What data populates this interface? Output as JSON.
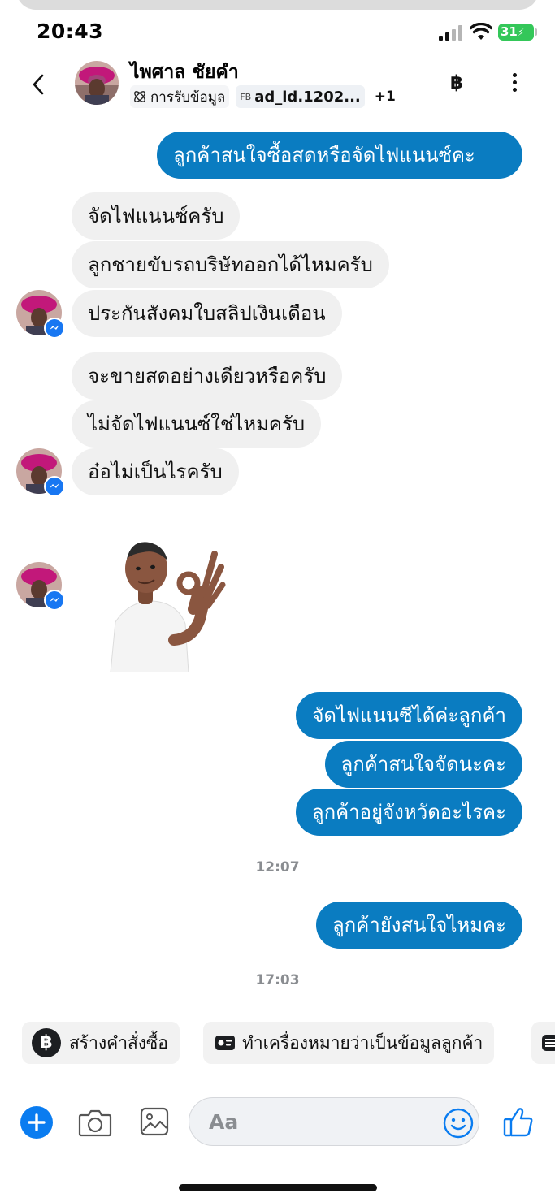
{
  "status_bar": {
    "time": "20:43",
    "battery": "31"
  },
  "header": {
    "contact_name": "ไพศาล ชัยคำ",
    "tag_label": "การรับข้อมูล",
    "ad_prefix": "FB",
    "ad_id": "ad_id.1202...",
    "more_tags": "+1",
    "currency_icon": "฿"
  },
  "messages": {
    "partial_outgoing": "ลูกค้าสนใจซื้อสดหรือจัดไฟแนนซ์คะ",
    "in_1": "จัดไฟแนนซ์ครับ",
    "in_2": "ลูกชายขับรถบริษัทออกได้ไหมครับ",
    "in_3": "ประกันสังคมใบสลิปเงินเดือน",
    "in_4": "จะขายสดอย่างเดียวหรือครับ",
    "in_5": "ไม่จัดไฟแนนซ์ใช่ไหมครับ",
    "in_6": "อ๋อไม่เป็นไรครับ",
    "out_1": "จัดไฟแนนซีได้ค่ะลูกค้า",
    "out_2": "ลูกค้าสนใจจัดนะคะ",
    "out_3": "ลูกค้าอยู่จังหวัดอะไรคะ",
    "time_1": "12:07",
    "out_4": "ลูกค้ายังสนใจไหมคะ",
    "time_2": "17:03"
  },
  "quick_replies": {
    "create_order_icon": "฿",
    "create_order": "สร้างคำสั่งซื้อ",
    "mark_customer": "ทำเครื่องหมายว่าเป็นข้อมูลลูกค้า"
  },
  "composer": {
    "placeholder": "Aa"
  },
  "colors": {
    "outgoing_bubble": "#0a7cc1",
    "incoming_bubble": "#f0f0f0",
    "accent": "#0a7cf0"
  }
}
